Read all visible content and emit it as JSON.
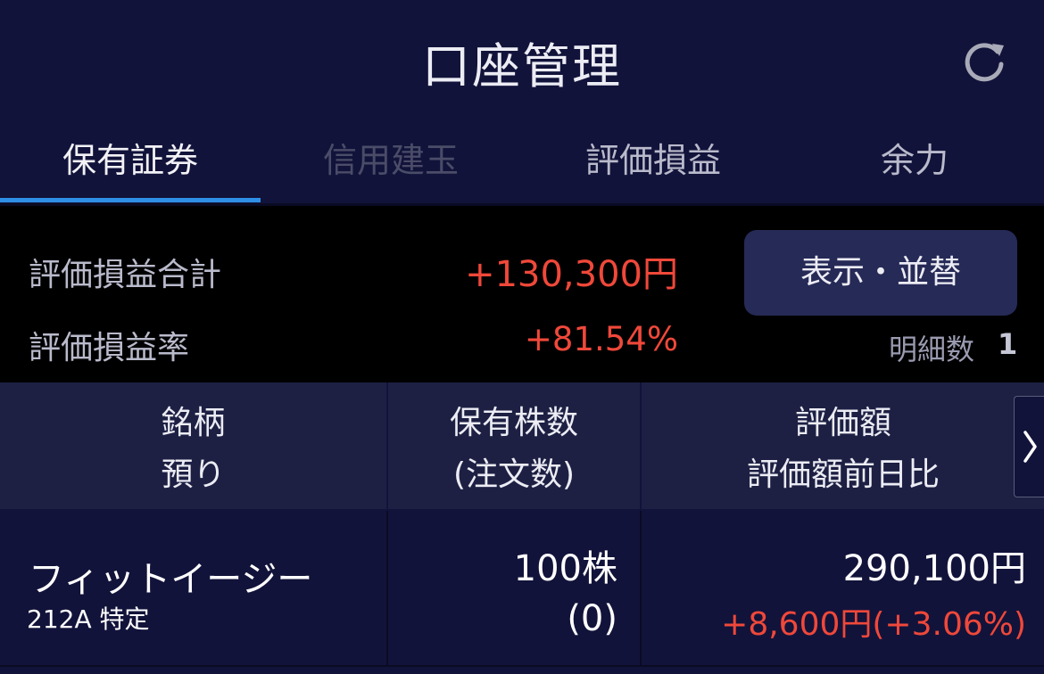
{
  "header": {
    "title": "口座管理",
    "refresh_icon": "refresh-icon"
  },
  "tabs": [
    {
      "label": "保有証券",
      "active": true
    },
    {
      "label": "信用建玉",
      "disabled": true
    },
    {
      "label": "評価損益"
    },
    {
      "label": "余力"
    }
  ],
  "summary": {
    "total_pl_label": "評価損益合計",
    "total_pl_value": "+130,300円",
    "pl_rate_label": "評価損益率",
    "pl_rate_value": "+81.54%",
    "sort_button_label": "表示・並替",
    "count_label": "明細数",
    "count_value": "1"
  },
  "table": {
    "headers": [
      {
        "line1": "銘柄",
        "line2": "預り"
      },
      {
        "line1": "保有株数",
        "line2": "(注文数)"
      },
      {
        "line1": "評価額",
        "line2": "評価額前日比"
      }
    ],
    "rows": [
      {
        "name": "フィットイージー",
        "sub": "212A 特定",
        "quantity": "100株",
        "order_quantity": "(0)",
        "value": "290,100円",
        "change": "+8,600円(+3.06%)"
      }
    ]
  },
  "colors": {
    "background": "#12133a",
    "positive": "#f0483a",
    "tab_active_underline": "#2f8fe6"
  }
}
